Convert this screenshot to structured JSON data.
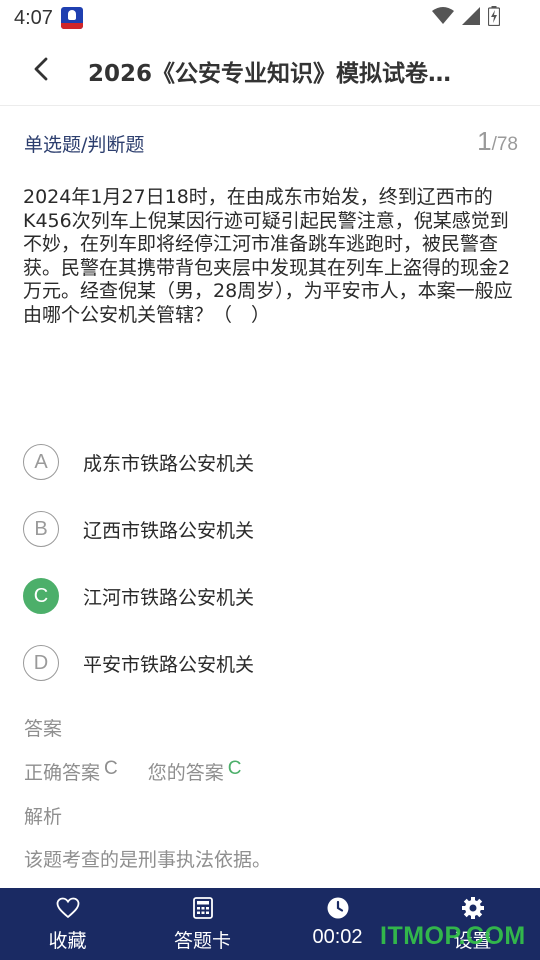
{
  "status_bar": {
    "time": "4:07"
  },
  "header": {
    "title": "2026《公安专业知识》模拟试卷…"
  },
  "question": {
    "type": "单选题/判断题",
    "current": "1",
    "total": "/78",
    "text": "2024年1月27日18时，在由成东市始发，终到辽西市的K456次列车上倪某因行迹可疑引起民警注意，倪某感觉到不妙，在列车即将经停江河市准备跳车逃跑时，被民警查获。民警在其携带背包夹层中发现其在列车上盗得的现金2万元。经查倪某（男，28周岁），为平安市人，本案一般应由哪个公安机关管辖？（　）"
  },
  "options": [
    {
      "letter": "A",
      "text": "成东市铁路公安机关",
      "selected": false
    },
    {
      "letter": "B",
      "text": "辽西市铁路公安机关",
      "selected": false
    },
    {
      "letter": "C",
      "text": "江河市铁路公安机关",
      "selected": true
    },
    {
      "letter": "D",
      "text": "平安市铁路公安机关",
      "selected": false
    }
  ],
  "answer": {
    "section_label": "答案",
    "correct_label": "正确答案",
    "correct_value": "C",
    "your_label": "您的答案",
    "your_value": "C"
  },
  "explanation": {
    "section_label": "解析",
    "text": "该题考查的是刑事执法依据。"
  },
  "bottom_bar": {
    "favorite_label": "收藏",
    "answer_card_label": "答题卡",
    "timer": "00:02",
    "settings_label": "设置"
  },
  "watermark": "ITMOP.COM",
  "colors": {
    "bottom_bar_bg": "#1a2a63",
    "selected_green": "#4caf6a",
    "type_label": "#2c3e6e",
    "muted_text": "#8f8f8f"
  }
}
